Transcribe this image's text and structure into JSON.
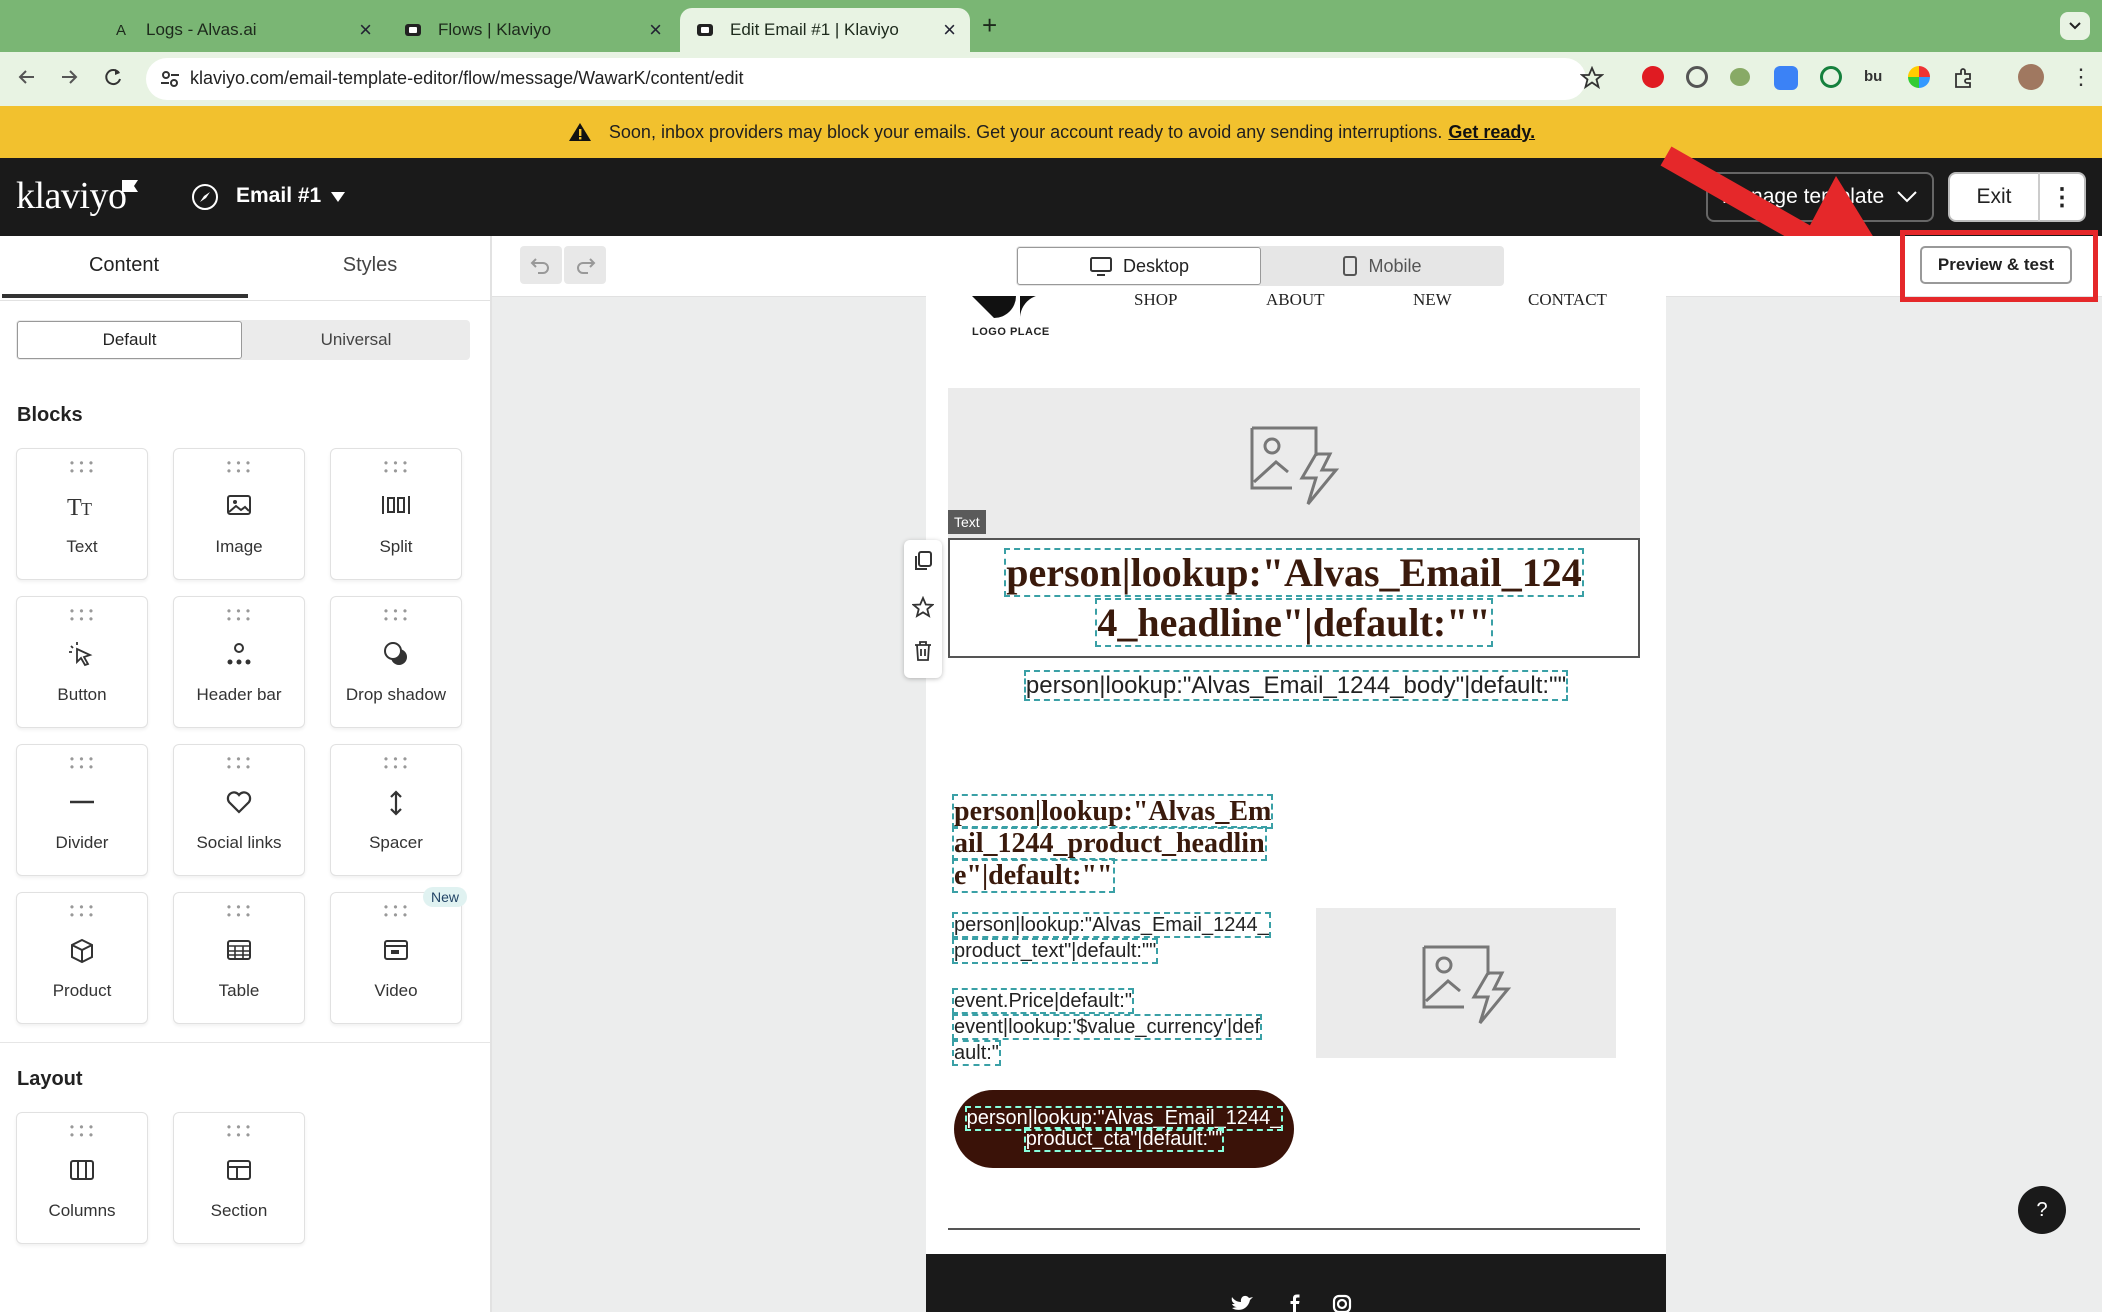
{
  "browser": {
    "tabs": [
      {
        "label": "Logs - Alvas.ai",
        "favicon": "A"
      },
      {
        "label": "Flows | Klaviyo",
        "favicon": "klaviyo-icon"
      },
      {
        "label": "Edit Email #1 | Klaviyo",
        "favicon": "klaviyo-icon"
      }
    ],
    "url": "klaviyo.com/email-template-editor/flow/message/WawarK/content/edit"
  },
  "banner": {
    "text": "Soon, inbox providers may block your emails. Get your account ready to avoid any sending interruptions.",
    "link": "Get ready."
  },
  "header": {
    "logo": "klaviyo",
    "email_name": "Email #1",
    "manage_template": "Manage template",
    "exit": "Exit"
  },
  "sidebar": {
    "tabs": [
      "Content",
      "Styles"
    ],
    "toggle": [
      "Default",
      "Universal"
    ],
    "blocks_heading": "Blocks",
    "blocks": [
      {
        "label": "Text",
        "icon": "text-icon"
      },
      {
        "label": "Image",
        "icon": "image-icon"
      },
      {
        "label": "Split",
        "icon": "split-icon"
      },
      {
        "label": "Button",
        "icon": "button-icon"
      },
      {
        "label": "Header bar",
        "icon": "header-bar-icon"
      },
      {
        "label": "Drop shadow",
        "icon": "drop-shadow-icon"
      },
      {
        "label": "Divider",
        "icon": "divider-icon"
      },
      {
        "label": "Social links",
        "icon": "heart-icon"
      },
      {
        "label": "Spacer",
        "icon": "spacer-icon"
      },
      {
        "label": "Product",
        "icon": "product-icon"
      },
      {
        "label": "Table",
        "icon": "table-icon"
      },
      {
        "label": "Video",
        "icon": "video-icon",
        "badge": "New"
      }
    ],
    "layout_heading": "Layout",
    "layout": [
      {
        "label": "Columns",
        "icon": "columns-icon"
      },
      {
        "label": "Section",
        "icon": "section-icon"
      }
    ]
  },
  "toolbar": {
    "desktop": "Desktop",
    "mobile": "Mobile",
    "preview": "Preview & test"
  },
  "email": {
    "logo_text": "LOGO PLACE",
    "nav": [
      "SHOP",
      "ABOUT",
      "NEW",
      "CONTACT"
    ],
    "text_tag": "Text",
    "headline": "person|lookup:\"Alvas_Email_1244_headline\"|default:\"\"",
    "headline_line1": "person|lookup:\"Alvas_Email_124",
    "headline_line2": "4_headline\"|default:\"\"",
    "body": "person|lookup:\"Alvas_Email_1244_body\"|default:\"\"",
    "product_headline_lines": [
      "person|lookup:\"Alvas_Em",
      "ail_1244_product_headlin",
      "e\"|default:\"\""
    ],
    "product_text_lines": [
      "person|lookup:\"Alvas_Email_1244_",
      "product_text\"|default:\"\""
    ],
    "price_lines": [
      "event.Price|default:\"",
      "event|lookup:'$value_currency'|def",
      "ault:\""
    ],
    "cta_lines": [
      "person|lookup:\"Alvas_Email_1244_",
      "product_cta\"|default:\"\""
    ]
  },
  "help": "?",
  "colors": {
    "tabbar": "#7ab674",
    "banner": "#f2c12e",
    "header": "#1a1a1a",
    "headline": "#3a1a0c",
    "cta_bg": "#3a1208",
    "highlight": "#e5282a"
  }
}
